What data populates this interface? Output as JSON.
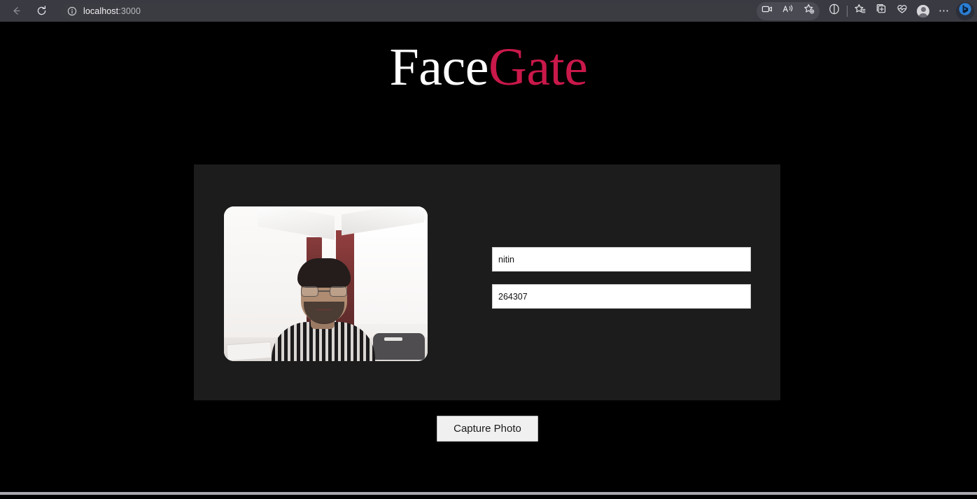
{
  "browser": {
    "back_icon": "back-arrow-icon",
    "reload_icon": "reload-icon",
    "url_info_icon": "site-info-icon",
    "url_host": "localhost",
    "url_port": ":3000",
    "chrome_bg": "#3a3a42",
    "url_pill_bg": "#3b3b42",
    "right_icons": [
      {
        "name": "video-capture-icon",
        "label": "Screenshot / capture"
      },
      {
        "name": "read-aloud-icon",
        "label": "Read aloud"
      },
      {
        "name": "add-favorite-icon",
        "label": "Add this page to favorites"
      },
      {
        "name": "split-screen-icon",
        "label": "Split screen"
      },
      {
        "name": "favorites-icon",
        "label": "Favorites"
      },
      {
        "name": "collections-icon",
        "label": "Collections"
      },
      {
        "name": "browser-essentials-icon",
        "label": "Browser essentials"
      },
      {
        "name": "profile-avatar-icon",
        "label": "Profile"
      },
      {
        "name": "settings-more-icon",
        "label": "Settings and more"
      },
      {
        "name": "copilot-bing-icon",
        "label": "Copilot"
      }
    ],
    "ellipsis_glyph": "⋯"
  },
  "page": {
    "background": "#000000",
    "logo": {
      "part_one": "Face",
      "part_two": "Gate",
      "part_one_color": "#ffffff",
      "part_two_color": "#c9184a"
    },
    "panel": {
      "background": "#1c1c1c",
      "video": {
        "name": "webcam-video-feed",
        "description": "Live webcam preview of a person wearing glasses and a striped shirt in a bright room with maroon curtains"
      },
      "form": {
        "name_field": {
          "value": "nitin",
          "placeholder": "Name"
        },
        "id_field": {
          "value": "264307",
          "placeholder": "ID"
        }
      }
    },
    "capture_button_label": "Capture Photo"
  }
}
